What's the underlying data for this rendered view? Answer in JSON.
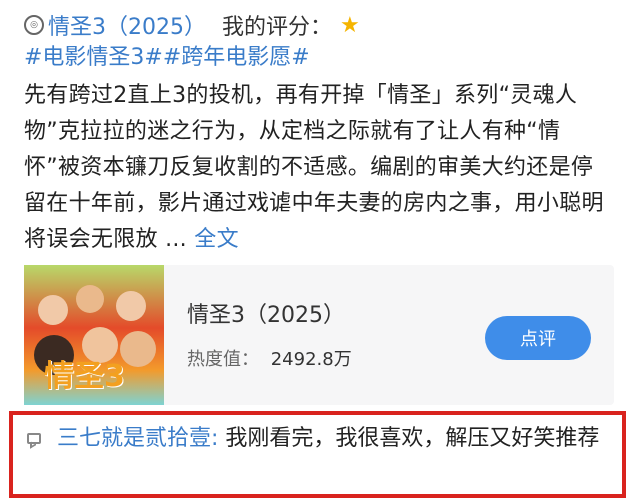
{
  "review": {
    "rating_icon": "rating-circle-icon",
    "film_title": "情圣3（2025）",
    "score_label": "我的评分：",
    "star_icon": "★",
    "hashtags": "#电影情圣3##跨年电影愿#",
    "body": "先有跨过2直上3的投机，再有开掉「情圣」系列“灵魂人物”克拉拉的迷之行为，从定档之际就有了让人有种“情怀”被资本镰刀反复收割的不适感。编剧的审美大约还是停留在十年前，影片通过戏谑中年夫妻的房内之事，用小聪明将误会无限放 ...",
    "more_label": "全文"
  },
  "movie_card": {
    "poster_title": "情圣3",
    "title": "情圣3（2025）",
    "heat_label": "热度值：",
    "heat_value": "2492.8万",
    "review_button": "点评"
  },
  "comment": {
    "icon": "comment-icon",
    "username": "三七就是贰拾壹:",
    "text": " 我刚看完，我很喜欢，解压又好笑推荐"
  },
  "colors": {
    "link": "#3a7cc9",
    "button": "#3f8de9",
    "highlight_border": "#d9231e",
    "star": "#f5b400"
  }
}
